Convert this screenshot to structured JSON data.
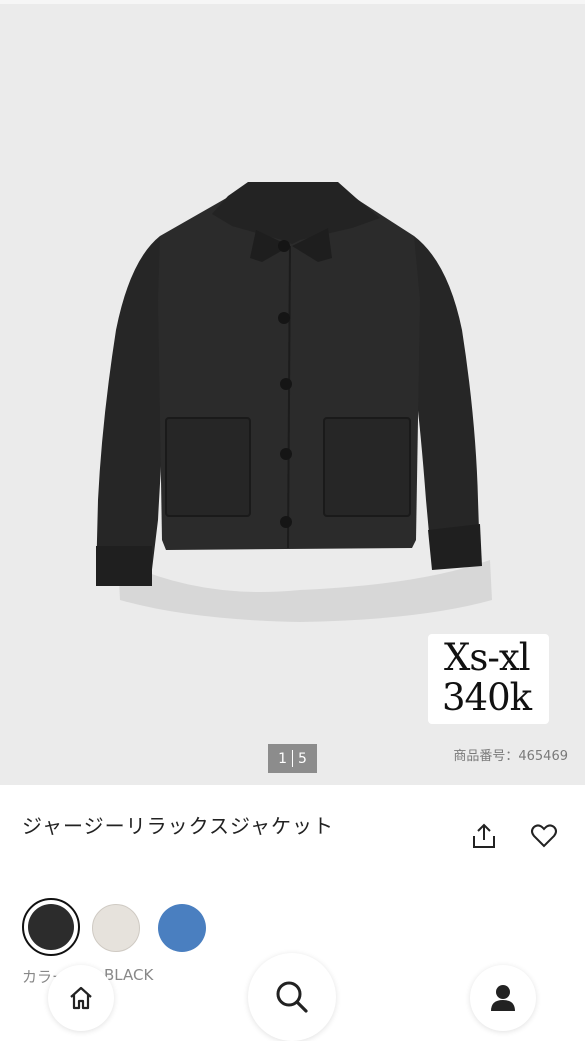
{
  "gallery": {
    "overlay_line1": "Xs-xl",
    "overlay_line2": "340k",
    "page_current": "1",
    "page_total": "5",
    "sku_text": "商品番号：465469"
  },
  "product": {
    "name": "ジャージーリラックスジャケット"
  },
  "colors": {
    "label": "カラー：",
    "selected_value": "BLACK",
    "options": [
      "#2c2c2c",
      "#e6e2dc",
      "#4a7fc0"
    ]
  },
  "nav": {
    "home_icon": "home-icon",
    "search_icon": "search-icon",
    "account_icon": "account-icon"
  }
}
